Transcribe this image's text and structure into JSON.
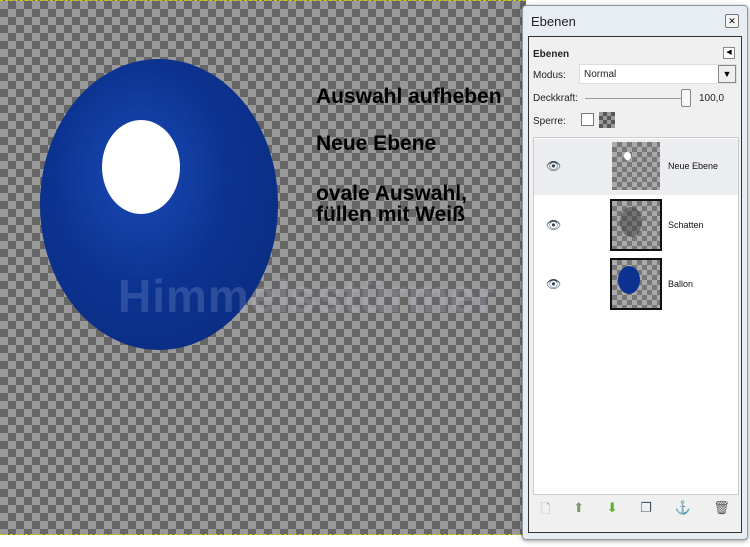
{
  "canvas": {
    "watermark": "Himmelsstürmer",
    "notes": [
      "Auswahl aufheben",
      "Neue Ebene",
      "ovale Auswahl,",
      "füllen mit Weiß"
    ]
  },
  "panel": {
    "title": "Ebenen",
    "header": "Ebenen",
    "mode_label": "Modus:",
    "mode_value": "Normal",
    "opacity_label": "Deckkraft:",
    "opacity_value": "100,0",
    "lock_label": "Sperre:",
    "layers": [
      {
        "name": "Neue Ebene"
      },
      {
        "name": "Schatten"
      },
      {
        "name": "Ballon"
      }
    ]
  },
  "colors": {
    "balloon": "#0c3391",
    "selected_row": "#ecedf0"
  }
}
